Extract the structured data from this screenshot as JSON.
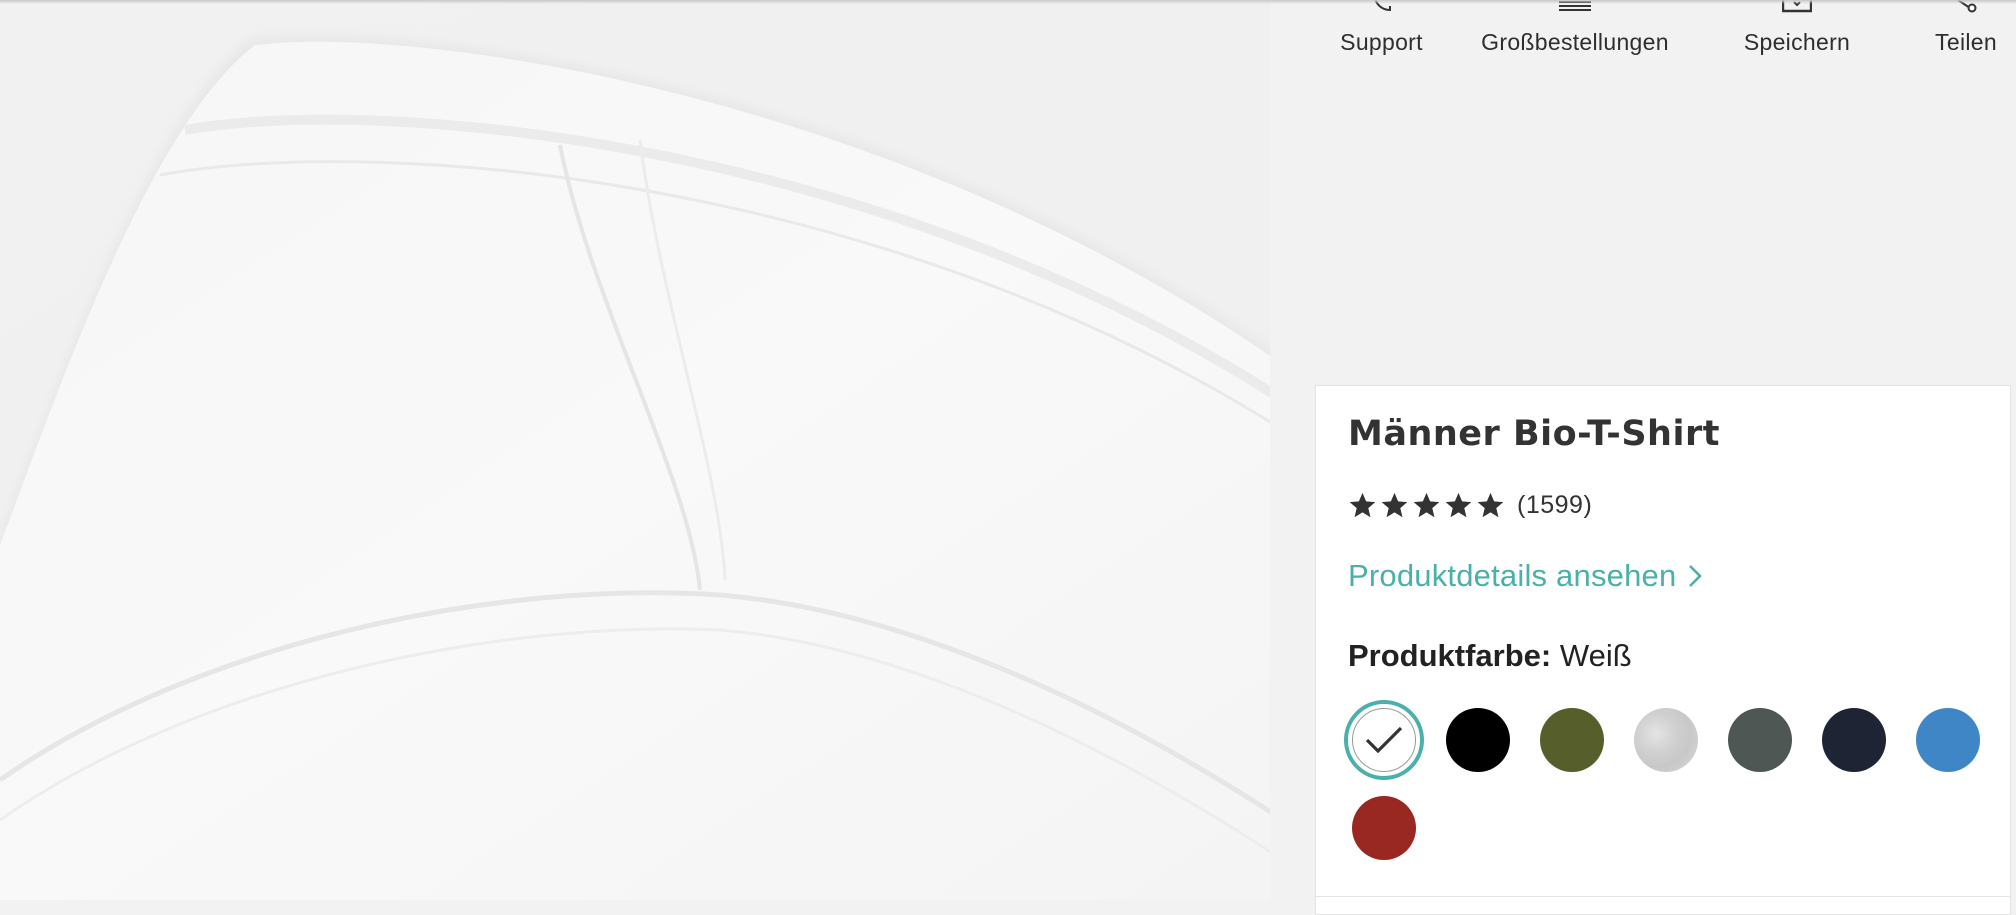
{
  "actions": [
    {
      "label": "Support",
      "icon": "phone-icon"
    },
    {
      "label": "Großbestellungen",
      "icon": "list-icon"
    },
    {
      "label": "Speichern",
      "icon": "bookmark-icon"
    },
    {
      "label": "Teilen",
      "icon": "share-icon"
    }
  ],
  "product": {
    "title": "Männer Bio-T-Shirt",
    "rating": 5,
    "rating_max": 5,
    "review_count": "(1599)",
    "details_link": "Produktdetails ansehen",
    "color_label": "Produktfarbe:",
    "color_value": "Weiß"
  },
  "colors": {
    "accent": "#4bb0a9",
    "swatches": [
      {
        "name": "Weiß",
        "hex": "#ffffff",
        "selected": true
      },
      {
        "name": "Schwarz",
        "hex": "#000000"
      },
      {
        "name": "Oliv",
        "hex": "#565e2c"
      },
      {
        "name": "Grau meliert",
        "hex": "#d0d0d0"
      },
      {
        "name": "Dunkelgrau",
        "hex": "#4f5754"
      },
      {
        "name": "Navy",
        "hex": "#1f2435"
      },
      {
        "name": "Blau",
        "hex": "#3e86c6"
      },
      {
        "name": "Rot",
        "hex": "#992823"
      }
    ]
  }
}
